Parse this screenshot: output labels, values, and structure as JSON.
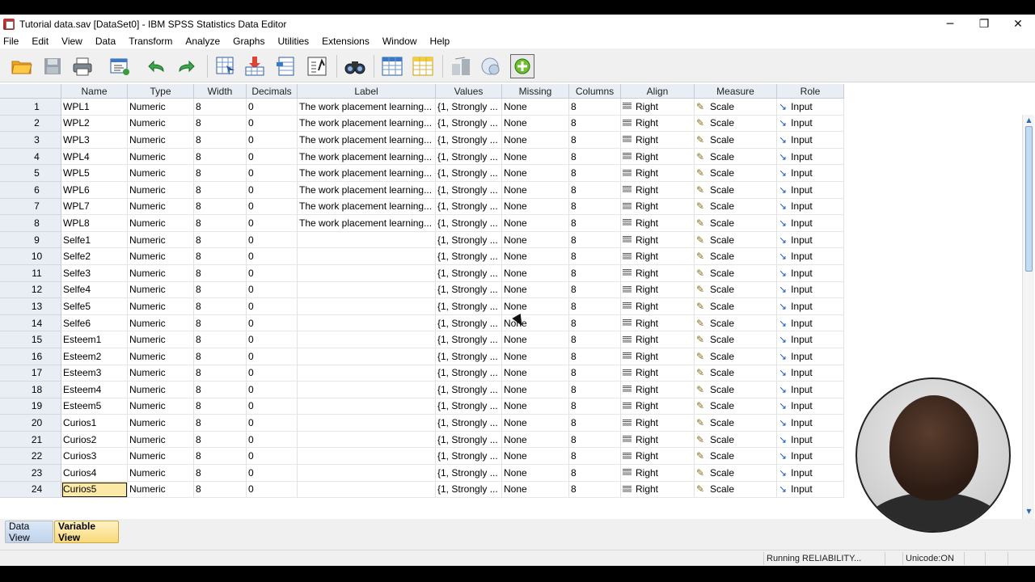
{
  "window": {
    "title": "Tutorial data.sav [DataSet0] - IBM SPSS Statistics Data Editor",
    "minimize": "─",
    "restore": "❐",
    "close": "✕"
  },
  "menu": [
    {
      "label": "File"
    },
    {
      "label": "Edit"
    },
    {
      "label": "View"
    },
    {
      "label": "Data"
    },
    {
      "label": "Transform"
    },
    {
      "label": "Analyze"
    },
    {
      "label": "Graphs"
    },
    {
      "label": "Utilities"
    },
    {
      "label": "Extensions"
    },
    {
      "label": "Window"
    },
    {
      "label": "Help"
    }
  ],
  "toolbar": {
    "icons": [
      "open-icon",
      "save-icon",
      "print-icon",
      "recall-dialog-icon",
      "undo-icon",
      "redo-icon",
      "goto-case-icon",
      "goto-variable-icon",
      "variables-icon",
      "run-descriptives-icon",
      "find-icon",
      "insert-cases-icon",
      "insert-variable-icon",
      "split-file-icon",
      "weight-cases-icon",
      "select-cases-icon",
      "value-labels-icon",
      "use-sets-icon"
    ]
  },
  "columns": [
    "Name",
    "Type",
    "Width",
    "Decimals",
    "Label",
    "Values",
    "Missing",
    "Columns",
    "Align",
    "Measure",
    "Role"
  ],
  "rows": [
    {
      "n": "1",
      "name": "WPL1",
      "type": "Numeric",
      "width": "8",
      "decimals": "0",
      "label": "The work placement learning...",
      "values": "{1, Strongly ...",
      "missing": "None",
      "columns": "8",
      "align": "Right",
      "measure": "Scale",
      "role": "Input"
    },
    {
      "n": "2",
      "name": "WPL2",
      "type": "Numeric",
      "width": "8",
      "decimals": "0",
      "label": "The work placement learning...",
      "values": "{1, Strongly ...",
      "missing": "None",
      "columns": "8",
      "align": "Right",
      "measure": "Scale",
      "role": "Input"
    },
    {
      "n": "3",
      "name": "WPL3",
      "type": "Numeric",
      "width": "8",
      "decimals": "0",
      "label": "The work placement learning...",
      "values": "{1, Strongly ...",
      "missing": "None",
      "columns": "8",
      "align": "Right",
      "measure": "Scale",
      "role": "Input"
    },
    {
      "n": "4",
      "name": "WPL4",
      "type": "Numeric",
      "width": "8",
      "decimals": "0",
      "label": "The work placement learning...",
      "values": "{1, Strongly ...",
      "missing": "None",
      "columns": "8",
      "align": "Right",
      "measure": "Scale",
      "role": "Input"
    },
    {
      "n": "5",
      "name": "WPL5",
      "type": "Numeric",
      "width": "8",
      "decimals": "0",
      "label": "The work placement learning...",
      "values": "{1, Strongly ...",
      "missing": "None",
      "columns": "8",
      "align": "Right",
      "measure": "Scale",
      "role": "Input"
    },
    {
      "n": "6",
      "name": "WPL6",
      "type": "Numeric",
      "width": "8",
      "decimals": "0",
      "label": "The work placement learning...",
      "values": "{1, Strongly ...",
      "missing": "None",
      "columns": "8",
      "align": "Right",
      "measure": "Scale",
      "role": "Input"
    },
    {
      "n": "7",
      "name": "WPL7",
      "type": "Numeric",
      "width": "8",
      "decimals": "0",
      "label": "The work placement learning...",
      "values": "{1, Strongly ...",
      "missing": "None",
      "columns": "8",
      "align": "Right",
      "measure": "Scale",
      "role": "Input"
    },
    {
      "n": "8",
      "name": "WPL8",
      "type": "Numeric",
      "width": "8",
      "decimals": "0",
      "label": "The work placement learning...",
      "values": "{1, Strongly ...",
      "missing": "None",
      "columns": "8",
      "align": "Right",
      "measure": "Scale",
      "role": "Input"
    },
    {
      "n": "9",
      "name": "Selfe1",
      "type": "Numeric",
      "width": "8",
      "decimals": "0",
      "label": "",
      "values": "{1, Strongly ...",
      "missing": "None",
      "columns": "8",
      "align": "Right",
      "measure": "Scale",
      "role": "Input"
    },
    {
      "n": "10",
      "name": "Selfe2",
      "type": "Numeric",
      "width": "8",
      "decimals": "0",
      "label": "",
      "values": "{1, Strongly ...",
      "missing": "None",
      "columns": "8",
      "align": "Right",
      "measure": "Scale",
      "role": "Input"
    },
    {
      "n": "11",
      "name": "Selfe3",
      "type": "Numeric",
      "width": "8",
      "decimals": "0",
      "label": "",
      "values": "{1, Strongly ...",
      "missing": "None",
      "columns": "8",
      "align": "Right",
      "measure": "Scale",
      "role": "Input"
    },
    {
      "n": "12",
      "name": "Selfe4",
      "type": "Numeric",
      "width": "8",
      "decimals": "0",
      "label": "",
      "values": "{1, Strongly ...",
      "missing": "None",
      "columns": "8",
      "align": "Right",
      "measure": "Scale",
      "role": "Input"
    },
    {
      "n": "13",
      "name": "Selfe5",
      "type": "Numeric",
      "width": "8",
      "decimals": "0",
      "label": "",
      "values": "{1, Strongly ...",
      "missing": "None",
      "columns": "8",
      "align": "Right",
      "measure": "Scale",
      "role": "Input"
    },
    {
      "n": "14",
      "name": "Selfe6",
      "type": "Numeric",
      "width": "8",
      "decimals": "0",
      "label": "",
      "values": "{1, Strongly ...",
      "missing": "None",
      "columns": "8",
      "align": "Right",
      "measure": "Scale",
      "role": "Input"
    },
    {
      "n": "15",
      "name": "Esteem1",
      "type": "Numeric",
      "width": "8",
      "decimals": "0",
      "label": "",
      "values": "{1, Strongly ...",
      "missing": "None",
      "columns": "8",
      "align": "Right",
      "measure": "Scale",
      "role": "Input"
    },
    {
      "n": "16",
      "name": "Esteem2",
      "type": "Numeric",
      "width": "8",
      "decimals": "0",
      "label": "",
      "values": "{1, Strongly ...",
      "missing": "None",
      "columns": "8",
      "align": "Right",
      "measure": "Scale",
      "role": "Input"
    },
    {
      "n": "17",
      "name": "Esteem3",
      "type": "Numeric",
      "width": "8",
      "decimals": "0",
      "label": "",
      "values": "{1, Strongly ...",
      "missing": "None",
      "columns": "8",
      "align": "Right",
      "measure": "Scale",
      "role": "Input"
    },
    {
      "n": "18",
      "name": "Esteem4",
      "type": "Numeric",
      "width": "8",
      "decimals": "0",
      "label": "",
      "values": "{1, Strongly ...",
      "missing": "None",
      "columns": "8",
      "align": "Right",
      "measure": "Scale",
      "role": "Input"
    },
    {
      "n": "19",
      "name": "Esteem5",
      "type": "Numeric",
      "width": "8",
      "decimals": "0",
      "label": "",
      "values": "{1, Strongly ...",
      "missing": "None",
      "columns": "8",
      "align": "Right",
      "measure": "Scale",
      "role": "Input"
    },
    {
      "n": "20",
      "name": "Curios1",
      "type": "Numeric",
      "width": "8",
      "decimals": "0",
      "label": "",
      "values": "{1, Strongly ...",
      "missing": "None",
      "columns": "8",
      "align": "Right",
      "measure": "Scale",
      "role": "Input"
    },
    {
      "n": "21",
      "name": "Curios2",
      "type": "Numeric",
      "width": "8",
      "decimals": "0",
      "label": "",
      "values": "{1, Strongly ...",
      "missing": "None",
      "columns": "8",
      "align": "Right",
      "measure": "Scale",
      "role": "Input"
    },
    {
      "n": "22",
      "name": "Curios3",
      "type": "Numeric",
      "width": "8",
      "decimals": "0",
      "label": "",
      "values": "{1, Strongly ...",
      "missing": "None",
      "columns": "8",
      "align": "Right",
      "measure": "Scale",
      "role": "Input"
    },
    {
      "n": "23",
      "name": "Curios4",
      "type": "Numeric",
      "width": "8",
      "decimals": "0",
      "label": "",
      "values": "{1, Strongly ...",
      "missing": "None",
      "columns": "8",
      "align": "Right",
      "measure": "Scale",
      "role": "Input"
    },
    {
      "n": "24",
      "name": "Curios5",
      "type": "Numeric",
      "width": "8",
      "decimals": "0",
      "label": "",
      "values": "{1, Strongly ...",
      "missing": "None",
      "columns": "8",
      "align": "Right",
      "measure": "Scale",
      "role": "Input",
      "selected": true
    }
  ],
  "tabs": {
    "data_view": "Data View",
    "variable_view": "Variable View"
  },
  "status": {
    "processor": "Running RELIABILITY...",
    "unicode": "Unicode:ON"
  },
  "colors": {
    "header_bg": "#e9eef5",
    "selected_cell": "#fbe9a7",
    "active_tab": "#f7d97a"
  }
}
